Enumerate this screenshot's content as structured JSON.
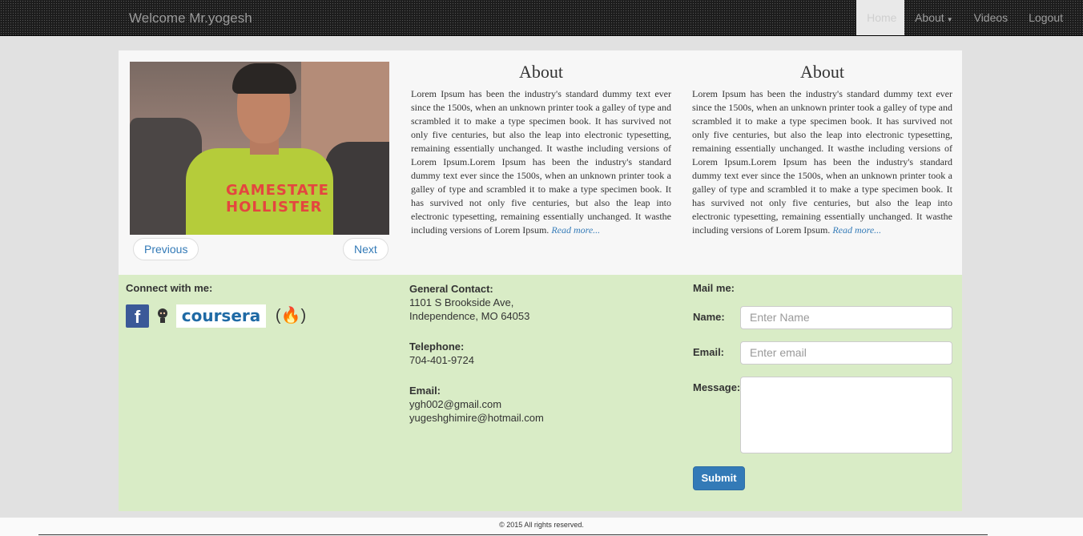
{
  "navbar": {
    "brand": "Welcome Mr.yogesh",
    "items": [
      {
        "label": "Home"
      },
      {
        "label": "About"
      },
      {
        "label": "Videos"
      },
      {
        "label": "Logout"
      }
    ]
  },
  "carousel": {
    "image_text": "GAMESTATE HOLLISTER",
    "prev_label": "Previous",
    "next_label": "Next"
  },
  "about_columns": [
    {
      "title": "About",
      "body": "Lorem Ipsum has been the industry's standard dummy text ever since the 1500s, when an unknown printer took a galley of type and scrambled it to make a type specimen book. It has survived not only five centuries, but also the leap into electronic typesetting, remaining essentially unchanged. It wasthe including versions of Lorem Ipsum.Lorem Ipsum has been the industry's standard dummy text ever since the 1500s, when an unknown printer took a galley of type and scrambled it to make a type specimen book. It has survived not only five centuries, but also the leap into electronic typesetting, remaining essentially unchanged. It wasthe including versions of Lorem Ipsum.",
      "link": "Read more..."
    },
    {
      "title": "About",
      "body": "Lorem Ipsum has been the industry's standard dummy text ever since the 1500s, when an unknown printer took a galley of type and scrambled it to make a type specimen book. It has survived not only five centuries, but also the leap into electronic typesetting, remaining essentially unchanged. It wasthe including versions of Lorem Ipsum.Lorem Ipsum has been the industry's standard dummy text ever since the 1500s, when an unknown printer took a galley of type and scrambled it to make a type specimen book. It has survived not only five centuries, but also the leap into electronic typesetting, remaining essentially unchanged. It wasthe including versions of Lorem Ipsum.",
      "link": "Read more..."
    }
  ],
  "connect": {
    "heading": "Connect with me:",
    "icons": [
      "facebook-icon",
      "github-icon",
      "coursera-logo",
      "freecodecamp-icon"
    ],
    "facebook_glyph": "f",
    "coursera_text": "coursera",
    "fcc_text": "(🔥)"
  },
  "contact": {
    "general_heading": "General Contact:",
    "address_line1": "1101 S Brookside Ave,",
    "address_line2": "Independence, MO 64053",
    "telephone_heading": "Telephone:",
    "telephone": "704-401-9724",
    "email_heading": "Email:",
    "email1": "ygh002@gmail.com",
    "email2": "yugeshghimire@hotmail.com"
  },
  "mail_form": {
    "heading": "Mail me:",
    "name_label": "Name:",
    "name_placeholder": "Enter Name",
    "email_label": "Email:",
    "email_placeholder": "Enter email",
    "message_label": "Message:",
    "submit_label": "Submit"
  },
  "footer": {
    "text": "© 2015 All rights reserved."
  },
  "colors": {
    "navbar_bg": "#1c1c1c",
    "page_bg": "#e1e1e1",
    "bottom_panel_bg": "#d9ecc6",
    "link": "#337ab7",
    "submit_bg": "#337ab7"
  }
}
